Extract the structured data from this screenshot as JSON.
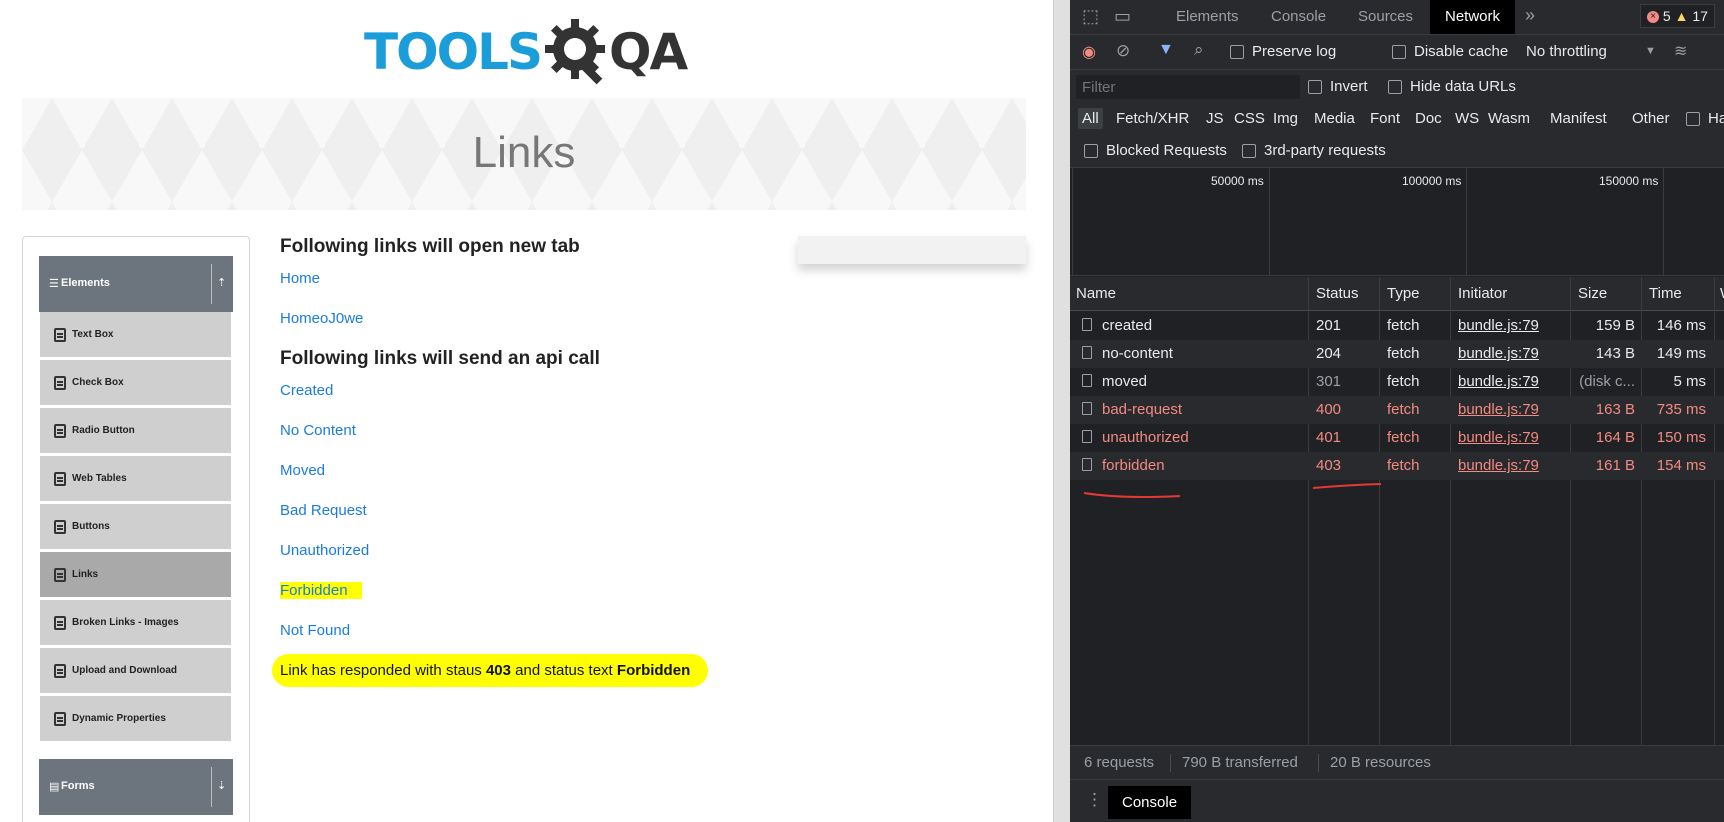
{
  "page": {
    "logo": {
      "part1": "TOOLS",
      "part2": "QA"
    },
    "banner_title": "Links",
    "sidebar": {
      "elements_header": "Elements",
      "items": [
        {
          "label": "Text Box"
        },
        {
          "label": "Check Box"
        },
        {
          "label": "Radio Button"
        },
        {
          "label": "Web Tables"
        },
        {
          "label": "Buttons"
        },
        {
          "label": "Links"
        },
        {
          "label": "Broken Links - Images"
        },
        {
          "label": "Upload and Download"
        },
        {
          "label": "Dynamic Properties"
        }
      ],
      "forms_header": "Forms"
    },
    "content": {
      "heading_new_tab": "Following links will open new tab",
      "link_home": "Home",
      "link_dynamic_home": "HomeoJ0we",
      "heading_api": "Following links will send an api call",
      "api_links": [
        "Created",
        "No Content",
        "Moved",
        "Bad Request",
        "Unauthorized",
        "Forbidden",
        "Not Found"
      ],
      "response_prefix": "Link has responded with staus ",
      "response_code": "403",
      "response_middle": " and status text ",
      "response_text": "Forbidden"
    }
  },
  "devtools": {
    "tabs": [
      "Elements",
      "Console",
      "Sources",
      "Network"
    ],
    "active_tab": "Network",
    "error_count": "5",
    "warning_count": "17",
    "toolbar": {
      "preserve_log": "Preserve log",
      "disable_cache": "Disable cache",
      "throttling": "No throttling"
    },
    "filter": {
      "placeholder": "Filter",
      "invert": "Invert",
      "hide_data_urls": "Hide data URLs"
    },
    "types": [
      "All",
      "Fetch/XHR",
      "JS",
      "CSS",
      "Img",
      "Media",
      "Font",
      "Doc",
      "WS",
      "Wasm",
      "Manifest",
      "Other",
      "Ha"
    ],
    "blocked_requests": "Blocked Requests",
    "third_party": "3rd-party requests",
    "overview_ticks": [
      "50000 ms",
      "100000 ms",
      "150000 ms"
    ],
    "columns": [
      "Name",
      "Status",
      "Type",
      "Initiator",
      "Size",
      "Time",
      "W"
    ],
    "rows": [
      {
        "name": "created",
        "status": "201",
        "type": "fetch",
        "initiator": "bundle.js:79",
        "size": "159 B",
        "time": "146 ms"
      },
      {
        "name": "no-content",
        "status": "204",
        "type": "fetch",
        "initiator": "bundle.js:79",
        "size": "143 B",
        "time": "149 ms"
      },
      {
        "name": "moved",
        "status": "301",
        "type": "fetch",
        "initiator": "bundle.js:79",
        "size": "(disk c...",
        "time": "5 ms"
      },
      {
        "name": "bad-request",
        "status": "400",
        "type": "fetch",
        "initiator": "bundle.js:79",
        "size": "163 B",
        "time": "735 ms"
      },
      {
        "name": "unauthorized",
        "status": "401",
        "type": "fetch",
        "initiator": "bundle.js:79",
        "size": "164 B",
        "time": "150 ms"
      },
      {
        "name": "forbidden",
        "status": "403",
        "type": "fetch",
        "initiator": "bundle.js:79",
        "size": "161 B",
        "time": "154 ms"
      }
    ],
    "status_bar": {
      "requests": "6 requests",
      "transferred": "790 B transferred",
      "resources": "20 B resources"
    },
    "drawer_tab": "Console"
  },
  "colors": {
    "link": "#1a7ce3",
    "highlight": "#ffff00",
    "error_text": "#f28b82",
    "logo_blue": "#1b9dd9"
  }
}
